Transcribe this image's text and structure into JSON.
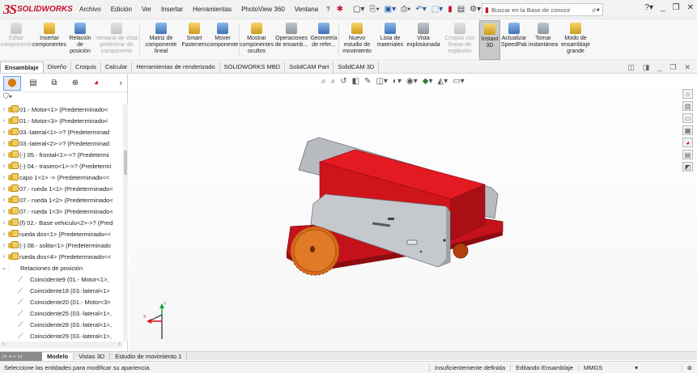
{
  "app": {
    "brand_prefix": "3S",
    "brand_name": "SOLIDWORKS"
  },
  "menu": [
    "Archivo",
    "Edición",
    "Ver",
    "Insertar",
    "Herramientas",
    "PhotoView 360",
    "Ventana",
    "?"
  ],
  "search": {
    "placeholder": "Buscar en la Base de conocir"
  },
  "ribbon": [
    {
      "label": "Editar componente",
      "enabled": false,
      "icon": "edit-component-icon"
    },
    {
      "label": "Insertar componentes",
      "enabled": true,
      "icon": "insert-components-icon"
    },
    {
      "label": "Relación de posición",
      "enabled": true,
      "icon": "mate-icon"
    },
    {
      "label": "Ventana de vista preliminar de componente",
      "enabled": false,
      "icon": "preview-window-icon"
    },
    {
      "label": "Matriz de componente lineal",
      "enabled": true,
      "icon": "linear-pattern-icon"
    },
    {
      "label": "Smart Fasteners",
      "enabled": true,
      "icon": "smart-fasteners-icon"
    },
    {
      "label": "Mover componente",
      "enabled": true,
      "icon": "move-component-icon"
    },
    {
      "label": "Mostrar componentes ocultos",
      "enabled": true,
      "icon": "show-hidden-icon"
    },
    {
      "label": "Operaciones de ensamb...",
      "enabled": true,
      "icon": "assembly-features-icon"
    },
    {
      "label": "Geometría de refer...",
      "enabled": true,
      "icon": "reference-geometry-icon"
    },
    {
      "label": "Nuevo estudio de movimiento",
      "enabled": true,
      "icon": "motion-study-icon"
    },
    {
      "label": "Lista de materiales",
      "enabled": true,
      "icon": "bom-icon"
    },
    {
      "label": "Vista explosionada",
      "enabled": true,
      "icon": "exploded-view-icon"
    },
    {
      "label": "Croquis con líneas de explosión",
      "enabled": false,
      "icon": "explode-line-sketch-icon"
    },
    {
      "label": "Instant 3D",
      "enabled": true,
      "active": true,
      "icon": "instant3d-icon"
    },
    {
      "label": "Actualizar SpeedPak",
      "enabled": true,
      "icon": "speedpak-icon"
    },
    {
      "label": "Tomar instantánea",
      "enabled": true,
      "icon": "snapshot-icon"
    },
    {
      "label": "Modo de ensamblaje grande",
      "enabled": true,
      "icon": "large-assembly-icon"
    }
  ],
  "command_tabs": [
    "Ensamblaje",
    "Diseño",
    "Croquis",
    "Calcular",
    "Herramientas de renderizado",
    "SOLIDWORKS MBD",
    "SolidCAM Part",
    "SolidCAM 3D"
  ],
  "active_command_tab": "Ensamblaje",
  "tree": {
    "filter_icon": "filter-icon",
    "components": [
      "01.- Motor<1> (Predeterminado<",
      "01.- Motor<3> (Predeterminado<",
      "03.-lateral<1>->? (Predeterminad",
      "03.-lateral<2>->? (Predeterminad",
      "(-) 05.- frontal<1>->? (Predetermi",
      "(-) 04.- trasero<1>->? (Predetermi",
      "capo 1<1> -> (Predeterminado<<",
      "07.- rueda 1<1> (Predeterminado<",
      "07.- rueda 1<2> (Predeterminado<",
      "07.- rueda 1<3> (Predeterminado<",
      "(f) 02.- Base vehiculo<2>->? (Pred",
      "rueda dos<1> (Predeterminado<<",
      "(-) 08.- solita<1> (Predeterminado",
      "rueda dos<4> (Predeterminado<<"
    ],
    "mates_group": "Relaciones de posición",
    "mates": [
      "Coincidente9 (01.- Motor<1>,",
      "Coincidente18 (03.-lateral<1>",
      "Coincidente20 (01.- Motor<3>",
      "Coincidente25 (03.-lateral<1>,",
      "Coincidente28 (03.-lateral<1>,",
      "Coincidente29 (03.-lateral<1>,"
    ]
  },
  "triad": {
    "x": "X",
    "y": "Y"
  },
  "bottom_tabs": [
    "Modelo",
    "Vistas 3D",
    "Estudio de movimiento 1"
  ],
  "active_bottom_tab": "Modelo",
  "status": {
    "message": "Seleccione las entidades para modificar su apariencia.",
    "definition": "Insuficientemente definida",
    "mode": "Editando Ensamblaje",
    "units": "MMGS",
    "units_arrow": "▾"
  },
  "colors": {
    "brand_red": "#c8102e",
    "body_red": "#d7141b",
    "panel_grey": "#b9bcc0"
  }
}
